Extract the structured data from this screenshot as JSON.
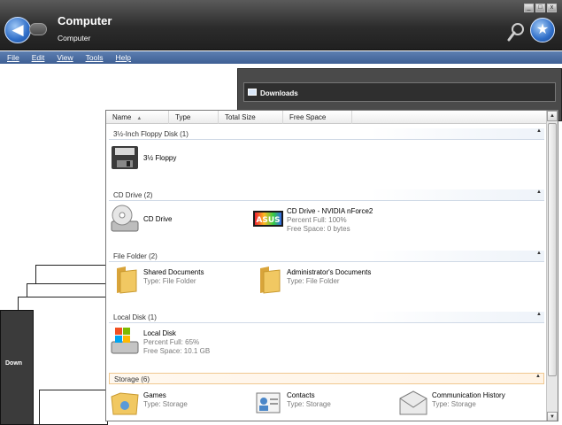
{
  "window": {
    "title": "Computer",
    "subtitle": "Computer"
  },
  "caption_buttons": [
    "_",
    "□",
    "x"
  ],
  "menu": [
    "File",
    "Edit",
    "View",
    "Tools",
    "Help"
  ],
  "background_window": {
    "title": "Downloads",
    "ghost_label": "Down"
  },
  "columns": [
    {
      "label": "Name",
      "sorted": true
    },
    {
      "label": "Type"
    },
    {
      "label": "Total Size"
    },
    {
      "label": "Free Space"
    }
  ],
  "groups": [
    {
      "label": "3½-Inch Floppy Disk (1)",
      "items": [
        {
          "name": "3½ Floppy",
          "icon": "floppy-drive-icon"
        }
      ]
    },
    {
      "label": "CD Drive (2)",
      "items": [
        {
          "name": "CD Drive",
          "icon": "cd-drive-icon"
        },
        {
          "name": "CD Drive - NVIDIA nForce2",
          "line2": "Percent Full: 100%",
          "line3": "Free Space: 0 bytes",
          "icon": "asus-disc-icon"
        }
      ]
    },
    {
      "label": "File Folder (2)",
      "items": [
        {
          "name": "Shared Documents",
          "line2": "Type: File Folder",
          "icon": "folder-icon"
        },
        {
          "name": "Administrator's Documents",
          "line2": "Type: File Folder",
          "icon": "folder-icon"
        }
      ]
    },
    {
      "label": "Local Disk (1)",
      "items": [
        {
          "name": "Local Disk",
          "line2": "Percent Full: 65%",
          "line3": "Free Space: 10.1 GB",
          "icon": "local-disk-icon"
        }
      ]
    },
    {
      "label": "Storage (6)",
      "items": [
        {
          "name": "Games",
          "line2": "Type: Storage",
          "icon": "games-folder-icon"
        },
        {
          "name": "Contacts",
          "line2": "Type: Storage",
          "icon": "contacts-icon"
        },
        {
          "name": "Communication History",
          "line2": "Type: Storage",
          "icon": "mail-icon"
        }
      ]
    }
  ],
  "colors": {
    "titlebar": "#2c2c2c",
    "menubar": "#4a6aa0",
    "folder": "#e8b84a",
    "accent": "#2f6ec8"
  }
}
